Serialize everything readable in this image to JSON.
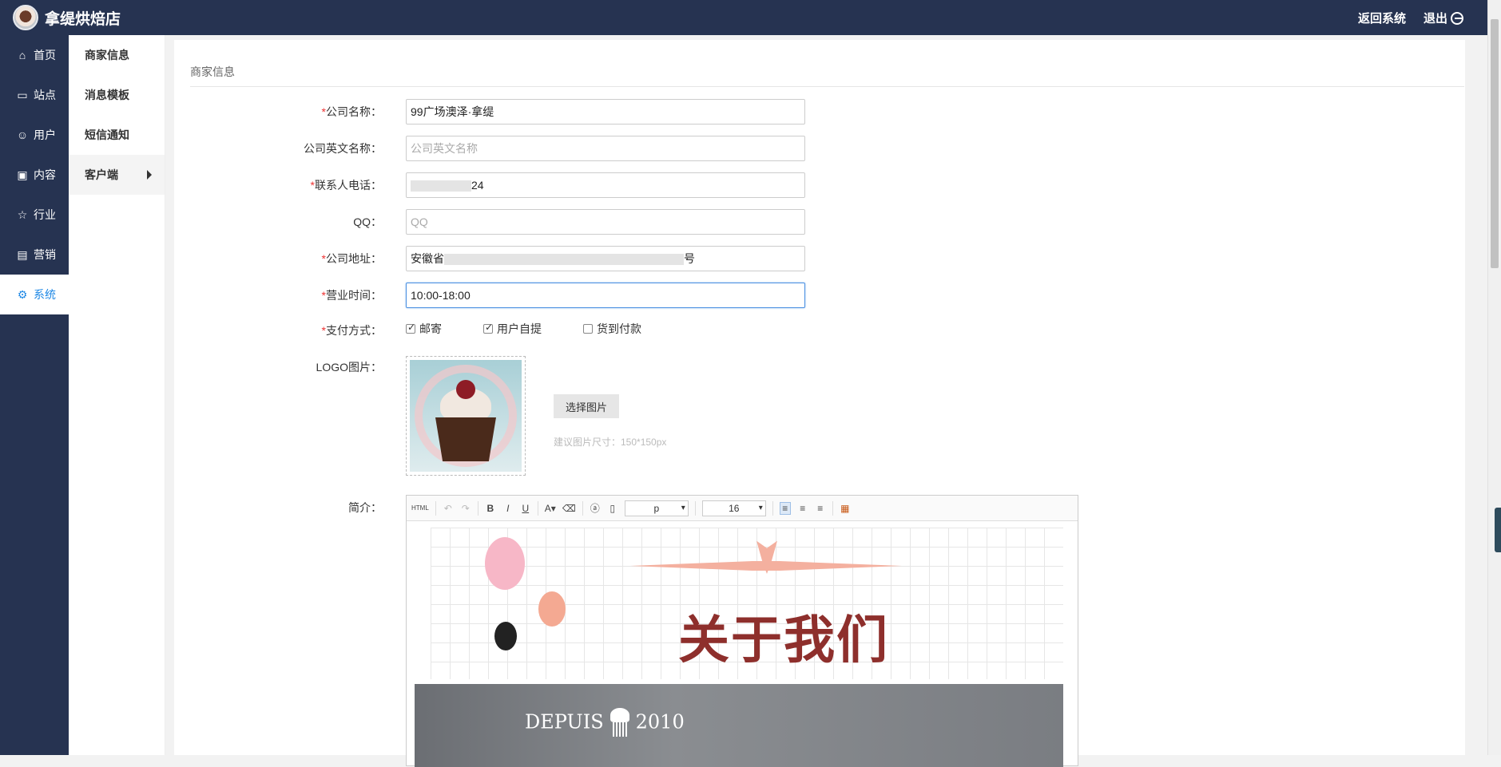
{
  "header": {
    "brand": "拿缇烘焙店",
    "back_label": "返回系统",
    "exit_label": "退出"
  },
  "left_nav": [
    {
      "label": "首页",
      "icon": "home-icon",
      "glyph": "⌂"
    },
    {
      "label": "站点",
      "icon": "monitor-icon",
      "glyph": "▭"
    },
    {
      "label": "用户",
      "icon": "user-icon",
      "glyph": "☺"
    },
    {
      "label": "内容",
      "icon": "inbox-icon",
      "glyph": "▣"
    },
    {
      "label": "行业",
      "icon": "star-icon",
      "glyph": "☆"
    },
    {
      "label": "营销",
      "icon": "wallet-icon",
      "glyph": "▤"
    },
    {
      "label": "系统",
      "icon": "gear-icon",
      "glyph": "⚙",
      "active": true
    }
  ],
  "sub_nav": [
    {
      "label": "商家信息"
    },
    {
      "label": "消息模板"
    },
    {
      "label": "短信通知"
    },
    {
      "label": "客户端",
      "active": true
    }
  ],
  "panel": {
    "title": "商家信息"
  },
  "form": {
    "company_name": {
      "label": "公司名称：",
      "required": "*",
      "value": "99广场澳泽·拿缇"
    },
    "company_en": {
      "label": "公司英文名称：",
      "placeholder": "公司英文名称"
    },
    "phone": {
      "label": "联系人电话：",
      "required": "*",
      "value_suffix": "24"
    },
    "qq": {
      "label": "QQ：",
      "placeholder": "QQ"
    },
    "address": {
      "label": "公司地址：",
      "required": "*",
      "value_prefix": "安徽省",
      "value_suffix": "号"
    },
    "hours": {
      "label": "营业时间：",
      "required": "*",
      "value": "10:00-18:00"
    },
    "payment": {
      "label": "支付方式：",
      "required": "*",
      "options": [
        {
          "label": "邮寄",
          "checked": true
        },
        {
          "label": "用户自提",
          "checked": true
        },
        {
          "label": "货到付款",
          "checked": false
        }
      ]
    },
    "logo": {
      "label": "LOGO图片：",
      "choose_label": "选择图片",
      "hint": "建议图片尺寸：150*150px"
    },
    "intro": {
      "label": "简介：",
      "toolbar": {
        "html": "HTML",
        "bold": "B",
        "italic": "I",
        "underline": "U",
        "font_color": "A",
        "format_select": "p",
        "size_select": "16"
      },
      "content": {
        "heading": "关于我们",
        "banner_left": "DEPUIS",
        "banner_right": "2010"
      }
    }
  }
}
